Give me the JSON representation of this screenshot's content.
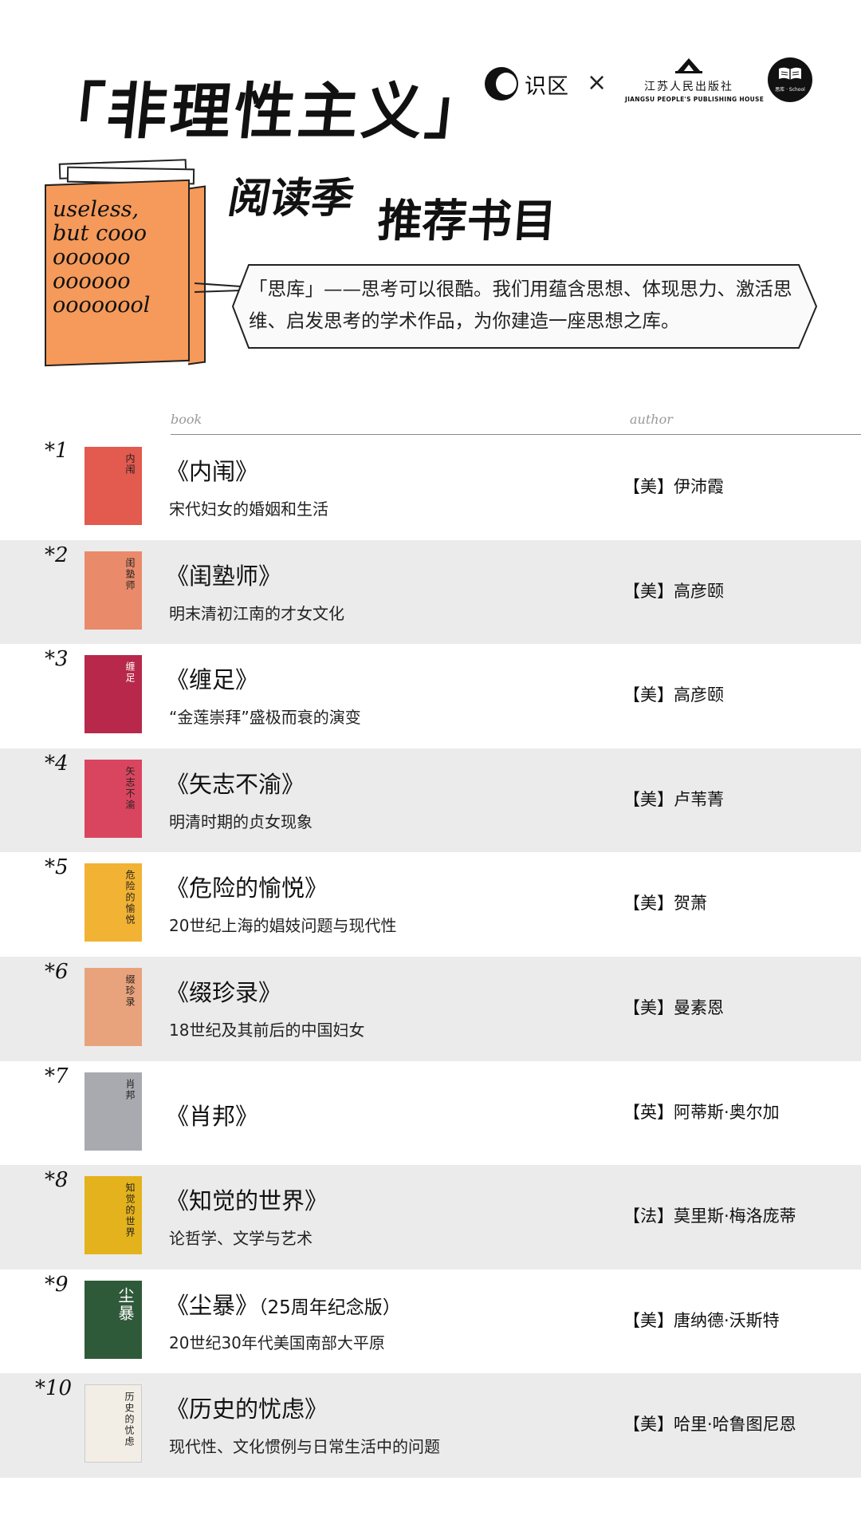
{
  "header": {
    "logo_shiqu": "识区",
    "logo_separator": "×",
    "publisher_cn": "江苏人民出版社",
    "publisher_en": "JIANGSU PEOPLE'S PUBLISHING HOUSE",
    "siku_caption": "思库 · School"
  },
  "title": "「非理性主义」",
  "subtitle_1": "阅读季",
  "subtitle_2": "推荐书目",
  "book_slogan": "useless,\nbut cooo\noooooo\noooooo\noooooool",
  "intro": "「思库」——思考可以很酷。我们用蕴含思想、体现思力、激活思维、启发思考的学术作品，为你建造一座思想之库。",
  "columns": {
    "book": "book",
    "author": "author"
  },
  "books": [
    {
      "num": "*1",
      "title": "《内闱》",
      "subtitle": "宋代妇女的婚姻和生活",
      "author": "【美】伊沛霞",
      "cover_color": "#e35a4f",
      "cover_title": "内闱"
    },
    {
      "num": "*2",
      "title": "《闺塾师》",
      "subtitle": "明末清初江南的才女文化",
      "author": "【美】高彦颐",
      "cover_color": "#e98a6b",
      "cover_title": "闺塾师"
    },
    {
      "num": "*3",
      "title": "《缠足》",
      "subtitle": "“金莲崇拜”盛极而衰的演变",
      "author": "【美】高彦颐",
      "cover_color": "#b8284a",
      "cover_title": "缠足"
    },
    {
      "num": "*4",
      "title": "《矢志不渝》",
      "subtitle": "明清时期的贞女现象",
      "author": "【美】卢苇菁",
      "cover_color": "#d9455f",
      "cover_title": "矢志不渝"
    },
    {
      "num": "*5",
      "title": "《危险的愉悦》",
      "subtitle": "20世纪上海的娼妓问题与现代性",
      "author": "【美】贺萧",
      "cover_color": "#f2b233",
      "cover_title": "危险的愉悦"
    },
    {
      "num": "*6",
      "title": "《缀珍录》",
      "subtitle": "18世纪及其前后的中国妇女",
      "author": "【美】曼素恩",
      "cover_color": "#e8a27c",
      "cover_title": "缀珍录"
    },
    {
      "num": "*7",
      "title": "《肖邦》",
      "subtitle": "",
      "author": "【英】阿蒂斯·奥尔加",
      "cover_color": "#a9a9b0",
      "cover_title": "肖邦"
    },
    {
      "num": "*8",
      "title": "《知觉的世界》",
      "subtitle": "论哲学、文学与艺术",
      "author": "【法】莫里斯·梅洛庞蒂",
      "cover_color": "#e3b21c",
      "cover_title": "知觉的世界"
    },
    {
      "num": "*9",
      "title": "《尘暴》",
      "title_extra": "（25周年纪念版）",
      "subtitle": "20世纪30年代美国南部大平原",
      "author": "【美】唐纳德·沃斯特",
      "cover_color": "#2f5a3a",
      "cover_title": "尘暴"
    },
    {
      "num": "*10",
      "title": "《历史的忧虑》",
      "subtitle": "现代性、文化惯例与日常生活中的问题",
      "author": "【美】哈里·哈鲁图尼恩",
      "cover_color": "#f2eee6",
      "cover_title": "历史的忧虑"
    }
  ]
}
